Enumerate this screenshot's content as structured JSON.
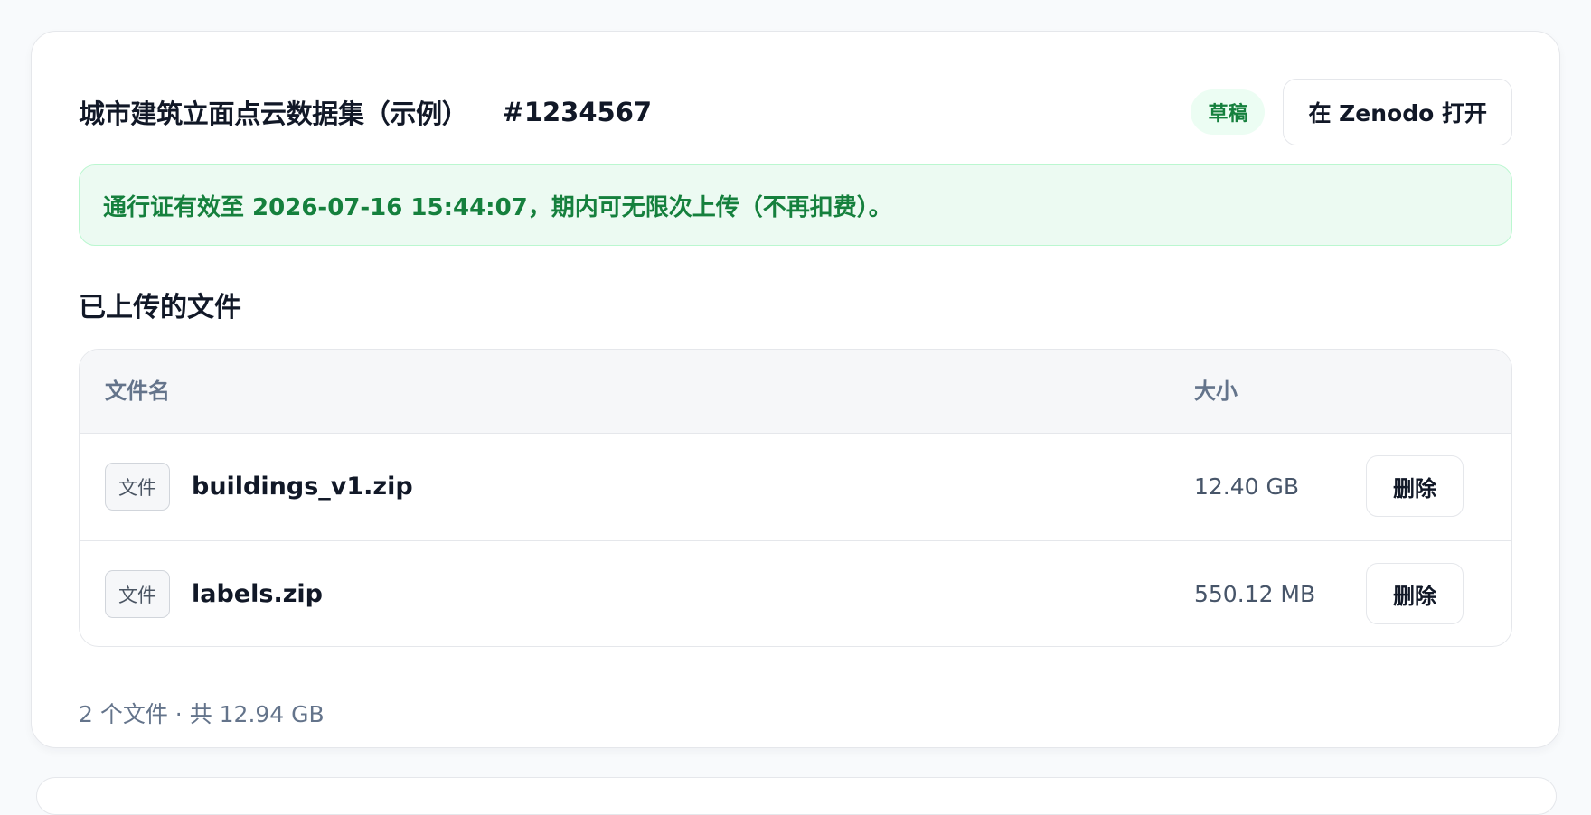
{
  "header": {
    "title": "城市建筑立面点云数据集（示例）",
    "record_id": "#1234567",
    "status_badge": "草稿",
    "open_button_label": "在 Zenodo 打开"
  },
  "pass_notice": {
    "text": "通行证有效至 2026-07-16 15:44:07，期内可无限次上传（不再扣费）。"
  },
  "files_section": {
    "title": "已上传的文件",
    "columns": {
      "name": "文件名",
      "size": "大小"
    },
    "rows": [
      {
        "tag": "文件",
        "name": "buildings_v1.zip",
        "size": "12.40 GB",
        "delete_label": "删除"
      },
      {
        "tag": "文件",
        "name": "labels.zip",
        "size": "550.12 MB",
        "delete_label": "删除"
      }
    ],
    "summary": "2 个文件 · 共 12.94 GB"
  },
  "colors": {
    "accent_green": "#15803d",
    "banner_background": "#ecfaf2",
    "border": "#e5e7eb",
    "muted_text": "#64748b"
  }
}
